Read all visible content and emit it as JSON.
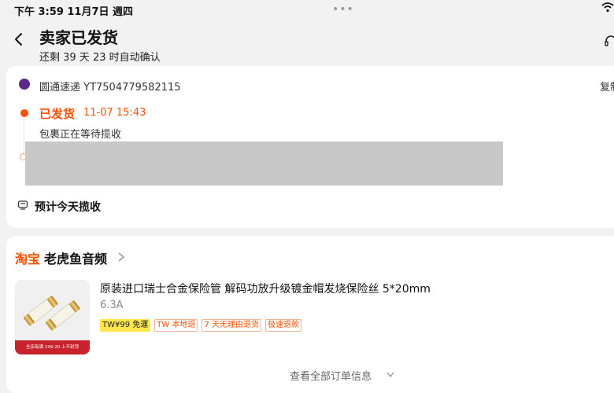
{
  "status_bar": {
    "time_date": "下午 3:59   11月7日 週四",
    "menu_dots": "•••"
  },
  "header": {
    "title": "卖家已发货",
    "subtitle": "还剩 39 天 23 时自动确认"
  },
  "shipment": {
    "carrier": "圆通速递 YT7504779582115",
    "copy_label": "复制",
    "status_label": "已发货",
    "status_time": "11-07 15:43",
    "status_desc": "包裹正在等待揽收",
    "pickup_estimate": "预计今天揽收"
  },
  "order": {
    "platform": "淘宝",
    "shop_name": "老虎鱼音频",
    "product": {
      "title": "原装进口瑞士合金保险管 解码功放升级镀金帽发烧保险丝  5*20mm",
      "spec": "6.3A",
      "thumb_banner": "全店每满 199-20 上不封顶",
      "tags": [
        "TW¥99 免運",
        "TW 本地退",
        "7 天无理由退货",
        "极速退款"
      ]
    },
    "view_all_label": "查看全部订单信息"
  },
  "colors": {
    "accent": "#ff5000",
    "promo_yellow": "#ffe64d"
  }
}
